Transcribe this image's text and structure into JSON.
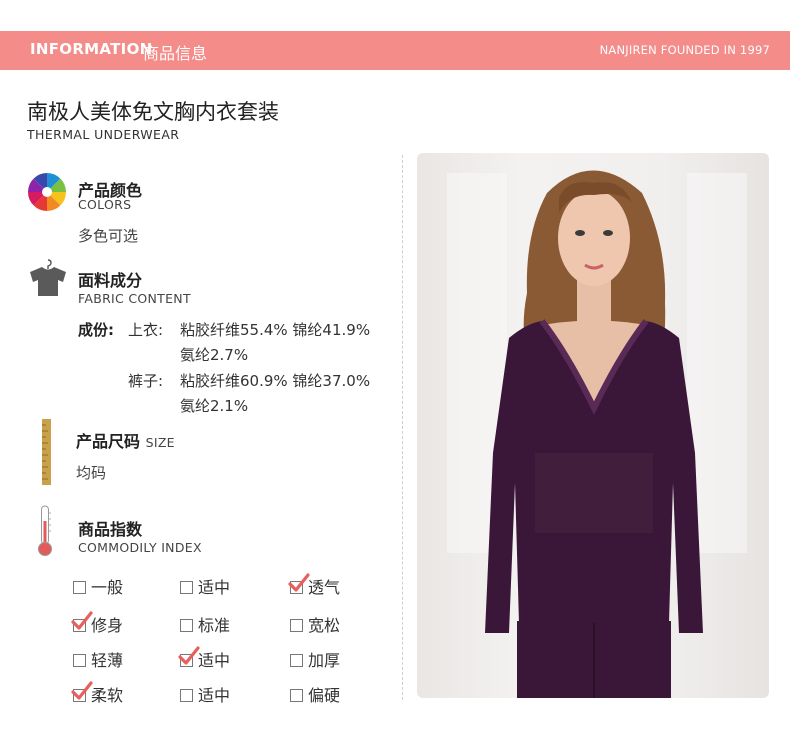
{
  "banner": {
    "label_en": "INFORMATION",
    "label_cn": "商品信息",
    "founded": "NANJIREN FOUNDED IN 1997"
  },
  "product": {
    "title": "南极人美体免文胸内衣套装",
    "subtitle": "THERMAL UNDERWEAR"
  },
  "colors": {
    "title": "产品颜色",
    "title_en": "COLORS",
    "value": "多色可选",
    "icon": "color-wheel-icon"
  },
  "fabric": {
    "title": "面料成分",
    "title_en": "FABRIC CONTENT",
    "icon": "shirt-hanger-icon",
    "lead": "成份:",
    "top_label": "上衣:",
    "top_line1": "粘胶纤维55.4%  锦纶41.9%",
    "top_line2": "氨纶2.7%",
    "bottom_label": "裤子:",
    "bottom_line1": "粘胶纤维60.9%  锦纶37.0%",
    "bottom_line2": "氨纶2.1%"
  },
  "size": {
    "title": "产品尺码",
    "title_en": "SIZE",
    "value": "均码",
    "icon": "ruler-icon"
  },
  "index": {
    "title": "商品指数",
    "title_en": "COMMODILY INDEX",
    "icon": "thermometer-icon",
    "rows": [
      [
        {
          "label": "一般",
          "checked": false
        },
        {
          "label": "适中",
          "checked": false
        },
        {
          "label": "透气",
          "checked": true
        }
      ],
      [
        {
          "label": "修身",
          "checked": true
        },
        {
          "label": "标准",
          "checked": false
        },
        {
          "label": "宽松",
          "checked": false
        }
      ],
      [
        {
          "label": "轻薄",
          "checked": false
        },
        {
          "label": "适中",
          "checked": true
        },
        {
          "label": "加厚",
          "checked": false
        }
      ],
      [
        {
          "label": "柔软",
          "checked": true
        },
        {
          "label": "适中",
          "checked": false
        },
        {
          "label": "偏硬",
          "checked": false
        }
      ]
    ]
  },
  "colors_accent": {
    "banner": "#f48c8a",
    "check": "#e8605e",
    "garment": "#3a1639"
  }
}
